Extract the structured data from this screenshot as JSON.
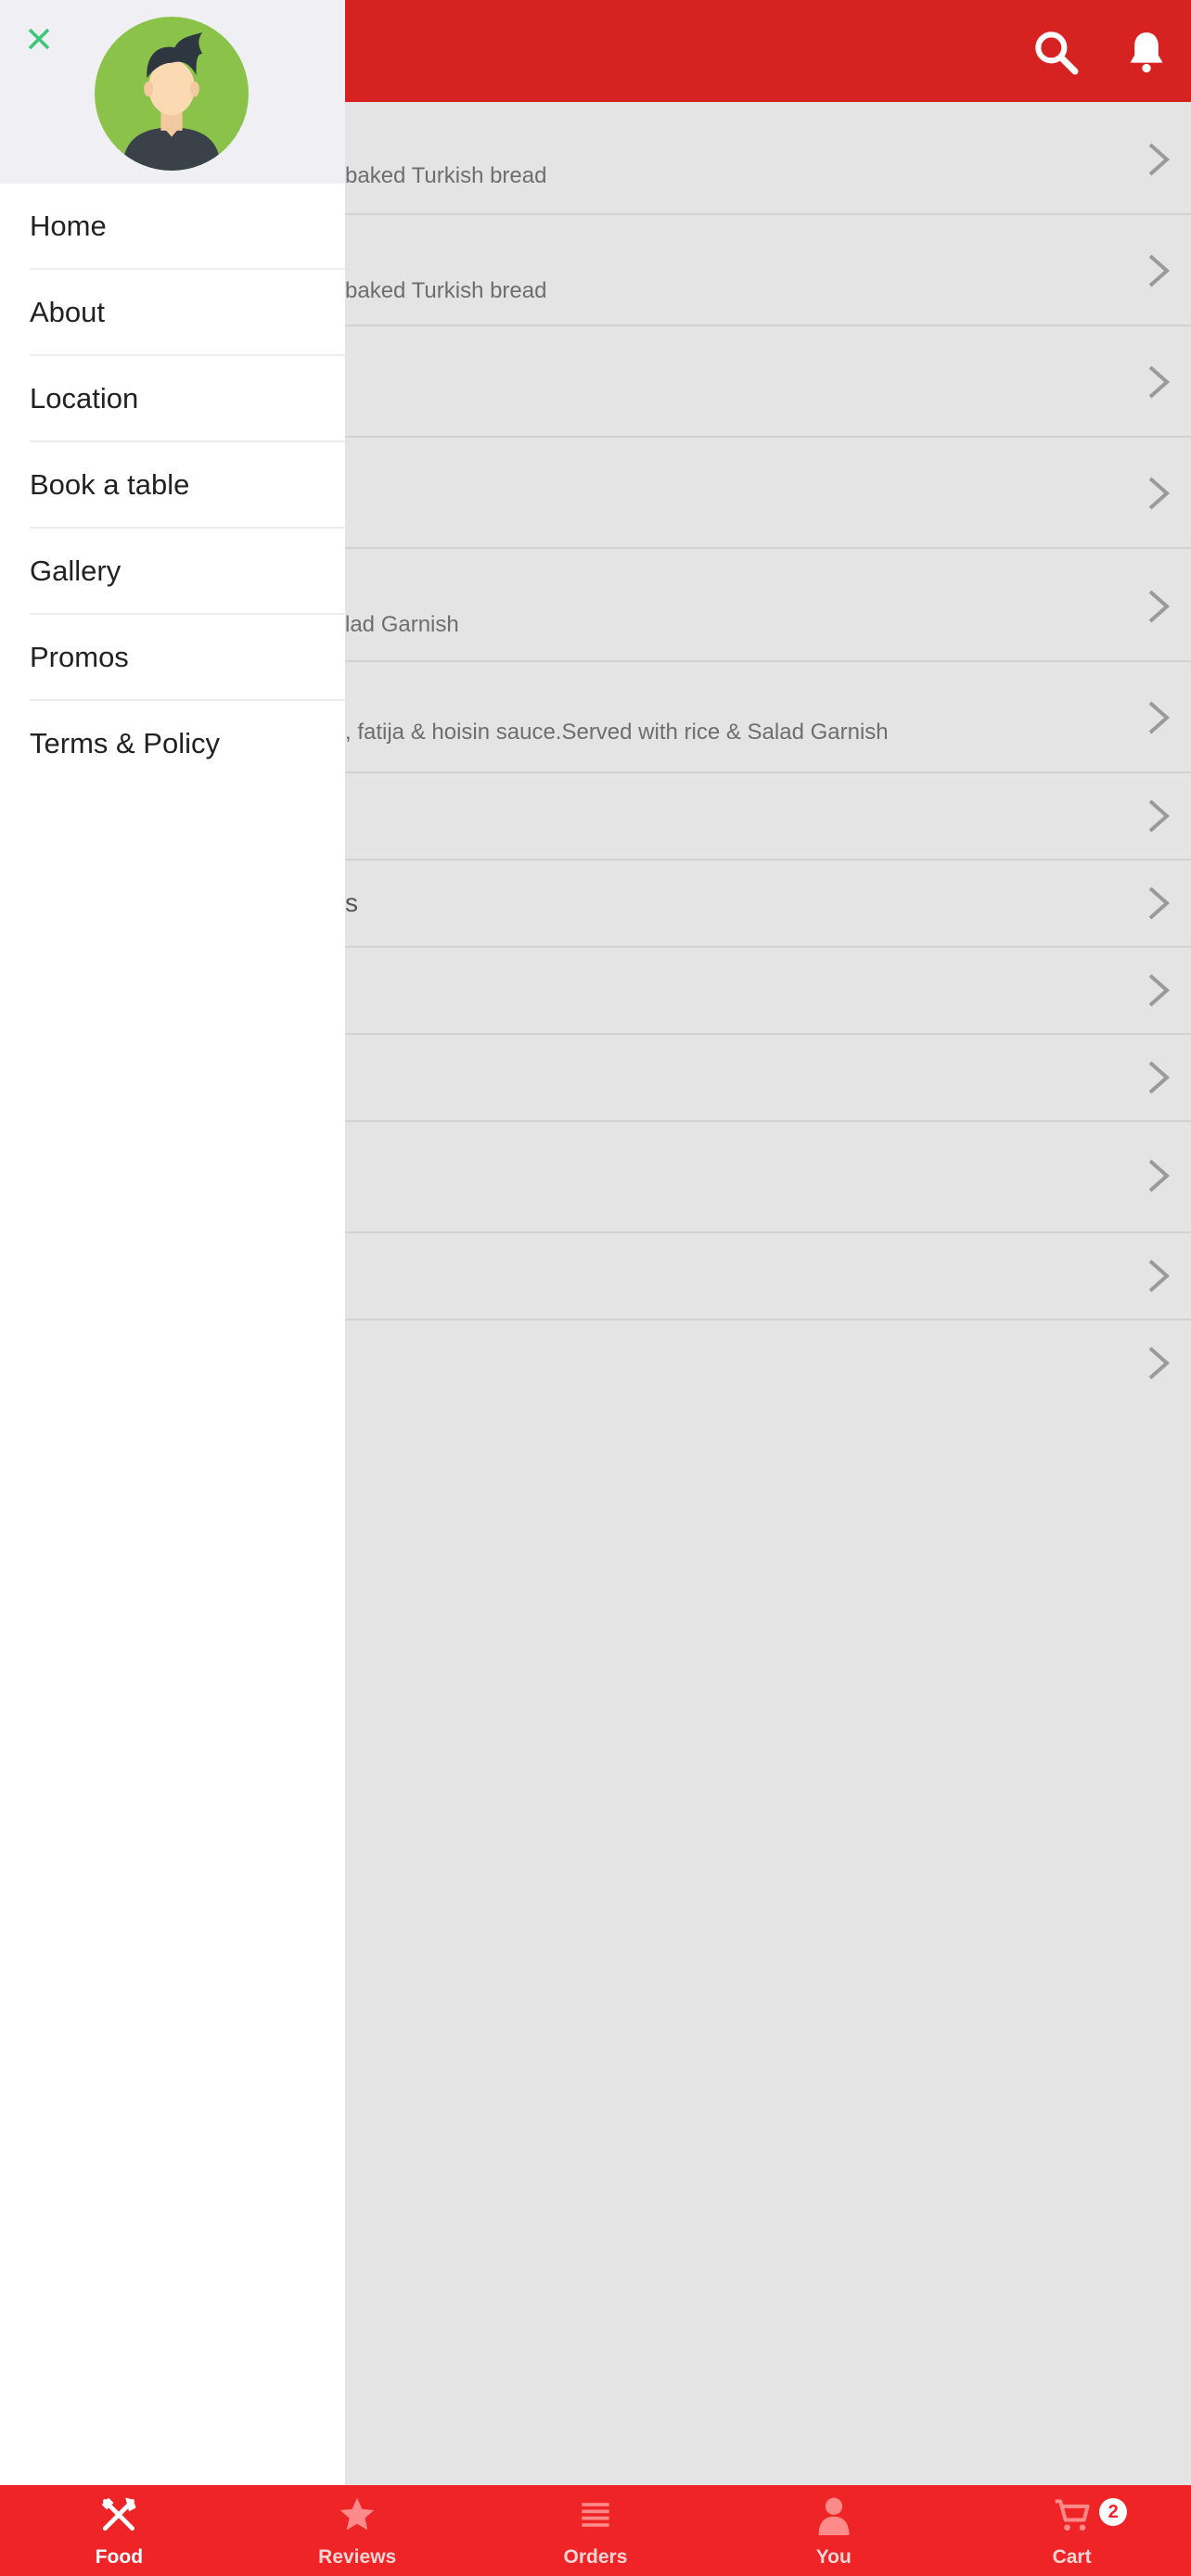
{
  "header": {
    "search_icon": "search-icon",
    "bell_icon": "bell-icon",
    "bar_color": "#d72222"
  },
  "menu_list": {
    "items": [
      {
        "title": "",
        "subtitle": "baked Turkish bread"
      },
      {
        "title": "",
        "subtitle": "baked Turkish bread"
      },
      {
        "title": "",
        "subtitle": ""
      },
      {
        "title": "",
        "subtitle": ""
      },
      {
        "title": "",
        "subtitle": "lad Garnish"
      },
      {
        "title": "",
        "subtitle": ", fatija & hoisin sauce.Served with rice & Salad Garnish"
      },
      {
        "title": "",
        "subtitle": ""
      },
      {
        "title": "s",
        "subtitle": ""
      },
      {
        "title": "",
        "subtitle": ""
      },
      {
        "title": "",
        "subtitle": ""
      },
      {
        "title": "",
        "subtitle": ""
      },
      {
        "title": "",
        "subtitle": ""
      },
      {
        "title": "",
        "subtitle": ""
      }
    ]
  },
  "drawer": {
    "close_icon": "close-icon",
    "close_color": "#3fc77a",
    "avatar_bg": "#8bc34a",
    "items": [
      {
        "label": "Home"
      },
      {
        "label": "About"
      },
      {
        "label": "Location"
      },
      {
        "label": "Book a table"
      },
      {
        "label": "Gallery"
      },
      {
        "label": "Promos"
      },
      {
        "label": "Terms & Policy"
      }
    ]
  },
  "tabbar": {
    "bg_color": "#ee2426",
    "tabs": [
      {
        "label": "Food",
        "icon": "fork-knife-icon"
      },
      {
        "label": "Reviews",
        "icon": "star-icon"
      },
      {
        "label": "Orders",
        "icon": "list-icon"
      },
      {
        "label": "You",
        "icon": "person-icon"
      },
      {
        "label": "Cart",
        "icon": "cart-icon",
        "badge": "2"
      }
    ]
  }
}
